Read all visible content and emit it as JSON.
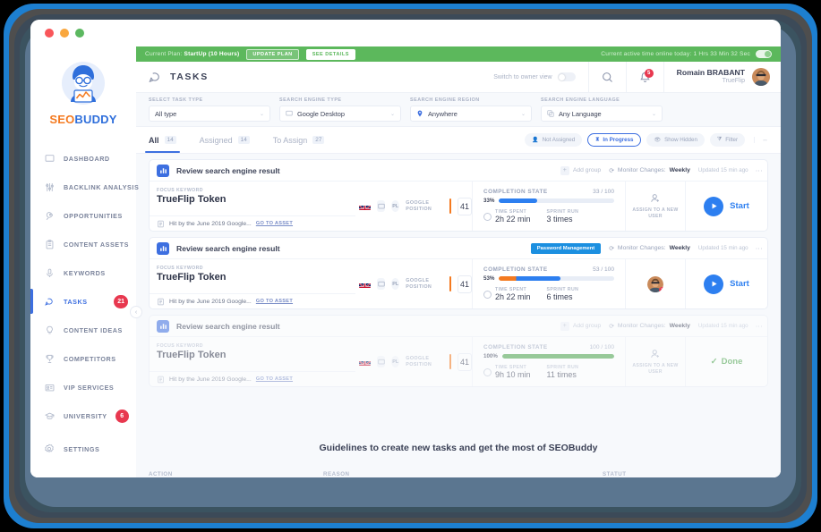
{
  "window": {
    "dots": [
      "close",
      "minimize",
      "maximize"
    ]
  },
  "sidebar": {
    "brand_part1": "SEO",
    "brand_part2": "BUDDY",
    "collapse_label": "‹",
    "items": [
      {
        "label": "DASHBOARD",
        "icon": "monitor-icon",
        "badge": ""
      },
      {
        "label": "BACKLINK ANALYSIS",
        "icon": "sliders-icon",
        "badge": ""
      },
      {
        "label": "OPPORTUNITIES",
        "icon": "rocket-icon",
        "badge": ""
      },
      {
        "label": "CONTENT ASSETS",
        "icon": "clipboard-icon",
        "badge": ""
      },
      {
        "label": "KEYWORDS",
        "icon": "microphone-icon",
        "badge": ""
      },
      {
        "label": "TASKS",
        "icon": "mouse-icon",
        "badge": "21"
      },
      {
        "label": "CONTENT IDEAS",
        "icon": "lightbulb-icon",
        "badge": ""
      },
      {
        "label": "COMPETITORS",
        "icon": "trophy-icon",
        "badge": ""
      },
      {
        "label": "VIP SERVICES",
        "icon": "card-icon",
        "badge": ""
      },
      {
        "label": "UNIVERSITY",
        "icon": "graduation-cap-icon",
        "badge": "6"
      }
    ],
    "settings": {
      "label": "SETTINGS",
      "icon": "gear-icon"
    }
  },
  "plan_bar": {
    "prefix": "Current Plan:",
    "plan": "StartUp (10 Hours)",
    "update_button": "UPDATE PLAN",
    "details_button": "SEE DETAILS",
    "active_time": "Current active time online today: 1 Hrs 33 Min 32 Sec"
  },
  "topbar": {
    "title": "TASKS",
    "title_icon": "mouse-icon",
    "owner_view_label": "Switch to owner view",
    "search_icon": "search-icon",
    "bell_icon": "bell-icon",
    "notification_count": "5",
    "user_name": "Romain BRABANT",
    "user_company": "TrueFlip"
  },
  "filters": [
    {
      "label": "SELECT TASK TYPE",
      "value": "All type",
      "icon": ""
    },
    {
      "label": "SEARCH ENGINE TYPE",
      "value": "Google Desktop",
      "icon": "monitor-icon"
    },
    {
      "label": "SEARCH ENGINE REGION",
      "value": "Anywhere",
      "icon": "pin-icon"
    },
    {
      "label": "SEARCH ENGINE LANGUAGE",
      "value": "Any Language",
      "icon": "translate-icon"
    }
  ],
  "tabs": [
    {
      "label": "All",
      "count": "14",
      "active": true
    },
    {
      "label": "Assigned",
      "count": "14",
      "active": false
    },
    {
      "label": "To Assign",
      "count": "27",
      "active": false
    }
  ],
  "chips": [
    {
      "label": "Not Assigned",
      "icon": "user-off-icon",
      "selected": false
    },
    {
      "label": "In Progress",
      "icon": "hourglass-icon",
      "selected": true
    },
    {
      "label": "Show Hidden",
      "icon": "eye-off-icon",
      "selected": false
    },
    {
      "label": "Filter",
      "icon": "funnel-icon",
      "selected": false
    }
  ],
  "expand_arrows": "↔",
  "tasks": [
    {
      "name": "Review search engine result",
      "icon": "chart-icon",
      "add_group_label": "Add group",
      "tag": "",
      "monitor_label": "Monitor Changes:",
      "monitor_value": "Weekly",
      "updated": "Updated 15 min ago",
      "keyword_label": "FOCUS KEYWORD",
      "keyword": "TrueFlip Token",
      "asset_text": "Hit by the June 2019 Google...",
      "asset_link": "GO TO ASSET",
      "flag": "uk-flag",
      "device": "desktop-icon",
      "lang": "PL",
      "position_label": "GOOGLE POSITION",
      "position": "41",
      "completion_label": "COMPLETION STATE",
      "completion_fraction": "33 / 100",
      "completion_percent": "33%",
      "completion_value": 33,
      "bar_color": "#2d7ff0",
      "time_spent_label": "TIME SPENT",
      "time_spent": "2h 22 min",
      "sprint_label": "SPRINT RUN",
      "sprint_run": "3 times",
      "assign_text": "ASSIGN TO A NEW USER",
      "assigned": false,
      "action": "Start",
      "action_type": "start"
    },
    {
      "name": "Review search engine result",
      "icon": "chart-icon",
      "add_group_label": "",
      "tag": "Password Management",
      "monitor_label": "Monitor Changes:",
      "monitor_value": "Weekly",
      "updated": "Updated 15 min ago",
      "keyword_label": "FOCUS KEYWORD",
      "keyword": "TrueFlip Token",
      "asset_text": "Hit by the June 2019 Google...",
      "asset_link": "GO TO ASSET",
      "flag": "uk-flag",
      "device": "desktop-icon",
      "lang": "PL",
      "position_label": "GOOGLE POSITION",
      "position": "41",
      "completion_label": "COMPLETION STATE",
      "completion_fraction": "53 / 100",
      "completion_percent": "53%",
      "completion_value": 53,
      "bar_color": "#f47a20",
      "time_spent_label": "TIME SPENT",
      "time_spent": "2h 22 min",
      "sprint_label": "SPRINT RUN",
      "sprint_run": "6 times",
      "assign_text": "",
      "assigned": true,
      "action": "Start",
      "action_type": "start"
    },
    {
      "name": "Review search engine result",
      "icon": "chart-icon",
      "add_group_label": "Add group",
      "tag": "",
      "monitor_label": "Monitor Changes:",
      "monitor_value": "Weekly",
      "updated": "Updated 15 min ago",
      "keyword_label": "FOCUS KEYWORD",
      "keyword": "TrueFlip Token",
      "asset_text": "Hit by the June 2019 Google...",
      "asset_link": "GO TO ASSET",
      "flag": "uk-flag",
      "device": "desktop-icon",
      "lang": "PL",
      "position_label": "GOOGLE POSITION",
      "position": "41",
      "completion_label": "COMPLETION STATE",
      "completion_fraction": "100 / 100",
      "completion_percent": "100%",
      "completion_value": 100,
      "bar_color": "#4aa34a",
      "time_spent_label": "TIME SPENT",
      "time_spent": "9h 10 min",
      "sprint_label": "SPRINT RUN",
      "sprint_run": "11 times",
      "assign_text": "ASSIGN TO A NEW USER",
      "assigned": false,
      "action": "Done",
      "action_type": "done"
    }
  ],
  "guidelines": {
    "title": "Guidelines to create new tasks and get the most of SEOBuddy",
    "col_action": "ACTION",
    "col_reason": "REASON",
    "col_status": "STATUT"
  },
  "colors": {
    "brand_blue": "#3d6fe0",
    "brand_orange": "#f47a20",
    "plan_green": "#5cb85c",
    "danger_red": "#e8384f",
    "action_blue": "#2d7ff0",
    "done_green": "#4aa34a"
  }
}
